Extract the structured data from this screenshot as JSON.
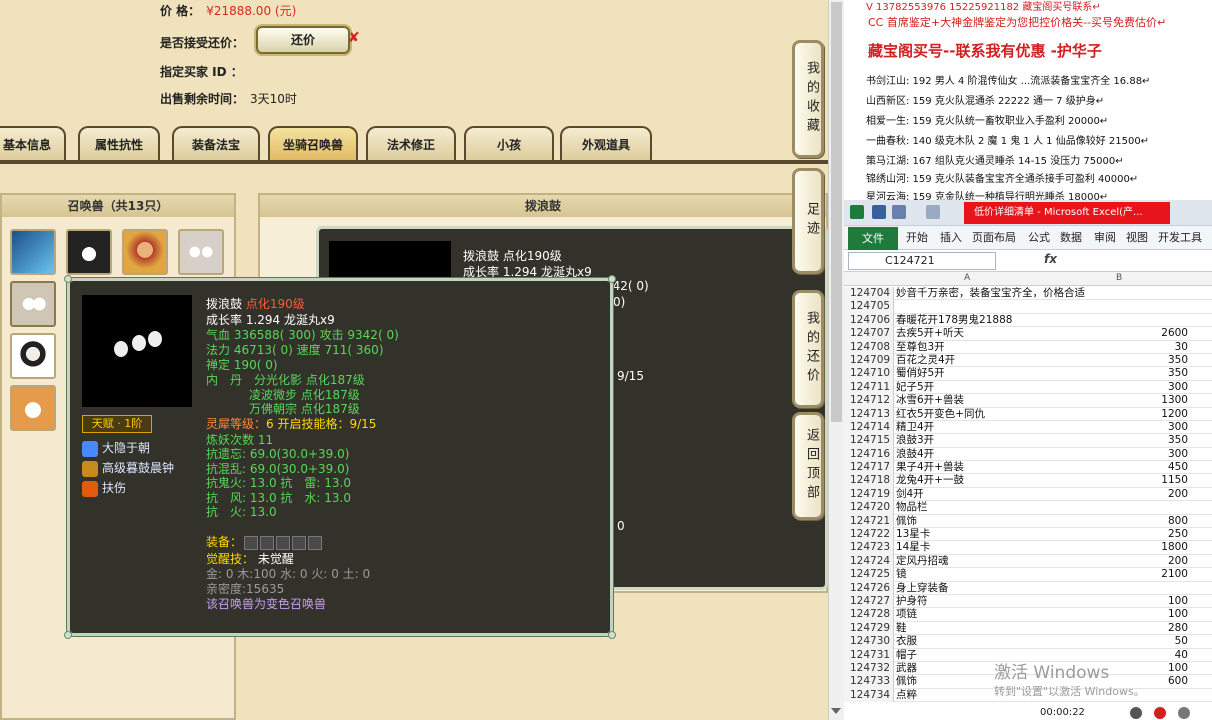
{
  "trade": {
    "price_label": "价      格：",
    "price_value": "¥21888.00 (元)",
    "counter_label": "是否接受还价：",
    "counter_button": "还价",
    "counter_x": "✘",
    "buyer_label": "指定买家 ID ：",
    "time_label": "出售剩余时间：",
    "time_value": "3天10时"
  },
  "tabs": [
    "基本信息",
    "属性抗性",
    "装备法宝",
    "坐骑召唤兽",
    "法术修正",
    "小孩",
    "外观道具"
  ],
  "active_tab": "坐骑召唤兽",
  "pets_panel": {
    "title": "召唤兽（共13只）"
  },
  "detail_panel": {
    "title": "拨浪鼓",
    "name": "拨浪鼓 点化190级",
    "growth": "成长率 1.294 龙涎丸x9",
    "partial_1": "342( 0)",
    "partial_2": "0)",
    "partial_3": "9/15",
    "partial_4": "0"
  },
  "tooltip": {
    "name": "拨浪鼓",
    "name_level": "点化190级",
    "growth": "成长率 1.294 龙涎丸x9",
    "hp_label": "气血",
    "hp": "336588( 300)",
    "atk_label": "攻击",
    "atk": "9342( 0)",
    "mp_label": "法力",
    "mp": "46713( 0)",
    "spd_label": "速度",
    "spd": "711( 360)",
    "sp_label": "禅定",
    "sp": "190( 0)",
    "neidan_label": "内　丹",
    "neidan_1": "分光化影 点化187级",
    "neidan_2": "凌波微步 点化187级",
    "neidan_3": "万佛朝宗 点化187级",
    "lingxi_label": "灵犀等级：",
    "lingxi": "6 开启技能格：9/15",
    "refine": "炼妖次数 11",
    "res_1": "抗遗忘: 69.0(30.0+39.0)",
    "res_2": "抗混乱: 69.0(30.0+39.0)",
    "res_3": "抗鬼火: 13.0 抗　雷: 13.0",
    "res_4": "抗　风: 13.0 抗　水: 13.0",
    "res_5": "抗　火: 13.0",
    "equip_label": "装备：",
    "awaken_label": "觉醒技：",
    "awaken": "未觉醒",
    "elements": "金: 0 木:100 水: 0 火: 0 土: 0",
    "intimacy": "亲密度:15635",
    "note": "该召唤兽为变色召唤兽",
    "talent": "天赋 · 1阶",
    "skills": [
      "大隐于朝",
      "高级暮鼓晨钟",
      "扶伤"
    ]
  },
  "right_nav": [
    "我的收藏",
    "足迹",
    "我的还价",
    "返回顶部"
  ],
  "ads": {
    "top_line": "V 13782553976   15225921182  藏宝阁买号联系↵",
    "cc_line": "CC 首席鉴定+大神金牌鉴定为您把控价格关--买号免费估价↵",
    "headline": "藏宝阁买号--联系我有优惠 -护华子",
    "items": [
      "书剑江山: 192 男人 4 阶混传仙女 ...流派装备宝宝齐全 16.88↵",
      "山西新区: 159 克火队混通杀 22222 通一 7 级护身↵",
      "相爱一生: 159 克火队统一畜牧职业入手盈利 20000↵",
      "一曲春秋: 140 级克木队 2 魔 1 鬼 1 人 1 仙品像较好 21500↵",
      "策马江湖: 167 组队克火通灵睡杀 14-15 没压力 75000↵",
      "锦绣山河: 159 克火队装备宝宝齐全通杀接手可盈利 40000↵",
      "星河云海: 159 克金队统一种植导行明光睡杀 18000↵"
    ]
  },
  "excel": {
    "window_title": "低价详细清单 - Microsoft Excel(产...",
    "file_tab": "文件",
    "menu": [
      "开始",
      "插入",
      "页面布局",
      "公式",
      "数据",
      "审阅",
      "视图",
      "开发工具"
    ],
    "name_box": "C124721",
    "fx": "fx",
    "col_a": "A",
    "col_b": "B",
    "rows": [
      [
        "124704",
        "妙音千万亲密，装备宝宝齐全，价格合适",
        ""
      ],
      [
        "124705",
        "",
        ""
      ],
      [
        "124706",
        "春暖花开178男鬼21888",
        ""
      ],
      [
        "124707",
        "去疾5开+听天",
        "2600"
      ],
      [
        "124708",
        "至尊包3开",
        "30"
      ],
      [
        "124709",
        "百花之灵4开",
        "350"
      ],
      [
        "124710",
        "蜀俏好5开",
        "350"
      ],
      [
        "124711",
        "妃子5开",
        "300"
      ],
      [
        "124712",
        "冰雪6开+兽装",
        "1300"
      ],
      [
        "124713",
        "红衣5开变色+同仇",
        "1200"
      ],
      [
        "124714",
        "精卫4开",
        "300"
      ],
      [
        "124715",
        "浪鼓3开",
        "350"
      ],
      [
        "124716",
        "浪鼓4开",
        "300"
      ],
      [
        "124717",
        "果子4开+兽装",
        "450"
      ],
      [
        "124718",
        "龙兔4开+一鼓",
        "1150"
      ],
      [
        "124719",
        "剑4开",
        "200"
      ],
      [
        "124720",
        "物品栏",
        ""
      ],
      [
        "124721",
        "佩饰",
        "800"
      ],
      [
        "124722",
        "13星卡",
        "250"
      ],
      [
        "124723",
        "14星卡",
        "1800"
      ],
      [
        "124724",
        "定风丹招魂",
        "200"
      ],
      [
        "124725",
        "镜",
        "2100"
      ],
      [
        "124726",
        "身上穿装备",
        ""
      ],
      [
        "124727",
        "护身符",
        "100"
      ],
      [
        "124728",
        "项链",
        "100"
      ],
      [
        "124729",
        "鞋",
        "280"
      ],
      [
        "124730",
        "衣服",
        "50"
      ],
      [
        "124731",
        "帽子",
        "40"
      ],
      [
        "124732",
        "武器",
        "100"
      ],
      [
        "124733",
        "佩饰",
        "600"
      ],
      [
        "124734",
        "点粹",
        ""
      ]
    ],
    "watermark": "激活 Windows",
    "watermark2": "转到\"设置\"以激活 Windows。",
    "timer": "00:00:22"
  }
}
